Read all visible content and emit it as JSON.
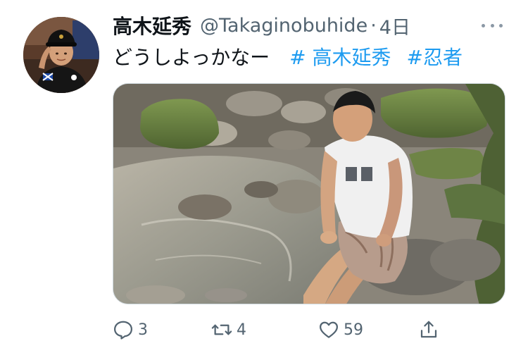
{
  "tweet": {
    "author_name": "高木延秀",
    "handle": "@Takaginobuhide",
    "separator": "·",
    "timestamp": "4日",
    "text": "どうしよっかなー",
    "hashtags": [
      "# 高木延秀",
      "#忍者"
    ]
  },
  "actions": {
    "reply_count": "3",
    "retweet_count": "4",
    "like_count": "59"
  },
  "icons": {
    "more": "more-dots-icon",
    "reply": "reply-icon",
    "retweet": "retweet-icon",
    "like": "heart-icon",
    "share": "share-icon"
  },
  "colors": {
    "hashtag": "#1d9bf0",
    "secondary_text": "#536471",
    "primary_text": "#0f1419"
  }
}
